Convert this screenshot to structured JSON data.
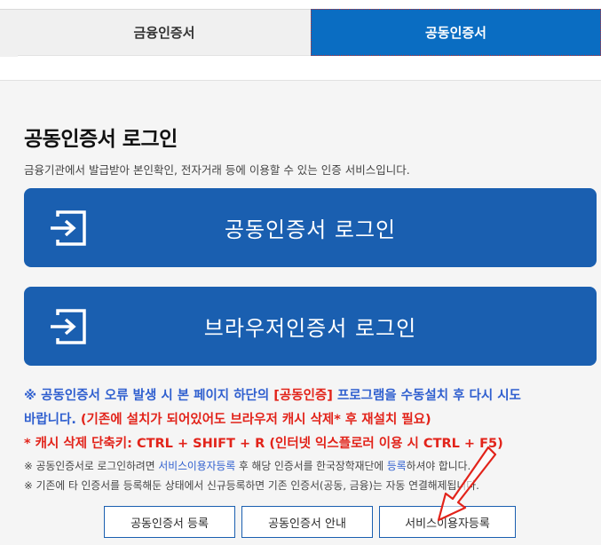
{
  "tabs": [
    {
      "label": "금융인증서",
      "active": false
    },
    {
      "label": "공동인증서",
      "active": true
    }
  ],
  "login": {
    "title": "공동인증서 로그인",
    "description": "금융기관에서 발급받아 본인확인, 전자거래 등에 이용할 수 있는 인증 서비스입니다.",
    "buttons": [
      {
        "label": "공동인증서 로그인",
        "icon": "sign-in-icon"
      },
      {
        "label": "브라우저인증서 로그인",
        "icon": "sign-in-icon"
      }
    ]
  },
  "notice": {
    "line1_prefix": "※ 공동인증서 오류 발생 시 본 페이지 하단의 ",
    "line1_highlight": "[공동인증]",
    "line1_suffix": " 프로그램을 수동설치 후 다시 시도",
    "line2_prefix": "바랍니다. ",
    "line2_highlight": "(기존에 설치가 되어있어도 브라우저 캐시 삭제* 후 재설치 필요)",
    "line3": "* 캐시 삭제 단축키: CTRL + SHIFT + R (인터넷 익스플로러 이용 시 CTRL + F5)",
    "small1_prefix": "※ 공동인증서로 로그인하려면 ",
    "small1_link": "서비스이용자등록",
    "small1_mid": " 후 해당 인증서를 한국장학재단에 ",
    "small1_link2": "등록",
    "small1_suffix": "하셔야 합니다.",
    "small2": "※ 기존에 타 인증서를 등록해둔 상태에서 신규등록하면 기존 인증서(공동, 금융)는 자동 연결해제됩니다."
  },
  "actions": [
    {
      "label": "공동인증서 등록"
    },
    {
      "label": "공동인증서 안내"
    },
    {
      "label": "서비스이용자등록"
    }
  ],
  "colors": {
    "primary": "#1a5fb0",
    "tab_active": "#0a6dc2",
    "notice_blue": "#2f5fcf",
    "notice_red": "#e2231a",
    "annotation_arrow": "#e2231a"
  }
}
